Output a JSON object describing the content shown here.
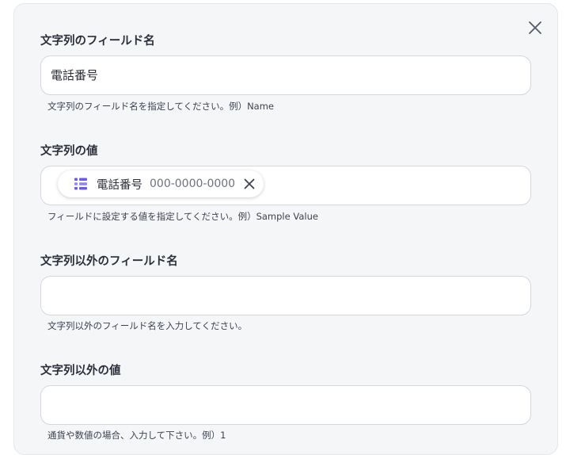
{
  "form": {
    "fields": [
      {
        "label": "文字列のフィールド名",
        "value": "電話番号",
        "hint": "文字列のフィールド名を指定してください。例）Name"
      },
      {
        "label": "文字列の値",
        "hint": "フィールドに設定する値を指定してください。例）Sample Value",
        "chip": {
          "name": "電話番号",
          "sample": "000-0000-0000",
          "icon": "data-block-icon"
        }
      },
      {
        "label": "文字列以外のフィールド名",
        "value": "",
        "hint": "文字列以外のフィールド名を入力してください。"
      },
      {
        "label": "文字列以外の値",
        "value": "",
        "hint": "通貨や数値の場合、入力して下さい。例）1"
      }
    ]
  },
  "icons": {
    "close": "close-icon",
    "remove": "remove-icon"
  },
  "colors": {
    "panel": "#f5f6f8",
    "chip_icon": "#6b5ce7",
    "text": "#2b2f3a"
  }
}
